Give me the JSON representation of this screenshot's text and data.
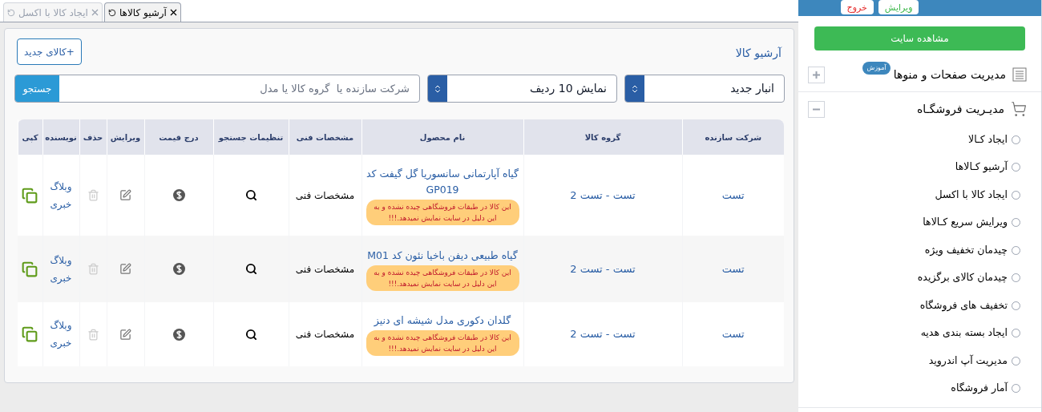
{
  "tabs": [
    {
      "label": "آرشیو کالاها",
      "selected": true
    },
    {
      "label": "ایجاد کالا با اکسل",
      "selected": false
    }
  ],
  "panel": {
    "title": "آرشیو کالا",
    "new_button": "+کالای جدید"
  },
  "filters": {
    "warehouse": "انبار جدید",
    "rows": "نمایش 10 ردیف",
    "search": {
      "placeholder": "شرکت سازنده یا  گروه کالا یا مدل"
    },
    "search_button": "جستجو"
  },
  "table": {
    "columns": [
      "شرکت سازنده",
      "گروه کالا",
      "نام محصول",
      "مشخصات فنی",
      "تنظیمات جستجو",
      "درج قیمت",
      "ویرایش",
      "حذف",
      "نویسنده",
      "کپی"
    ],
    "rows": [
      {
        "maker": "تست",
        "group": "تست - تست 2",
        "name": "گیاه آپارتمانی سانسوریا گل گیفت کد GP019",
        "warning": "این کالا در طبقات فروشگاهی چیده نشده و به این دلیل در سایت نمایش نمیدهد.!!!",
        "spec": "مشخصات فنی",
        "author": "وبلاگ خبری"
      },
      {
        "maker": "تست",
        "group": "تست - تست 2",
        "name": "گیاه طبیعی دیفن باخیا نئون کد M01",
        "warning": "این کالا در طبقات فروشگاهی چیده نشده و به این دلیل در سایت نمایش نمیدهد.!!!",
        "spec": "مشخصات فنی",
        "author": "وبلاگ خبری"
      },
      {
        "maker": "تست",
        "group": "تست - تست 2",
        "name": "گلدان دکوری مدل شیشه ای دنیز",
        "warning": "این کالا در طبقات فروشگاهی چیده نشده و به این دلیل در سایت نمایش نمیدهد.!!!",
        "spec": "مشخصات فنی",
        "author": "وبلاگ خبری"
      }
    ]
  },
  "sidebar": {
    "top_buttons": [
      {
        "label": "ویرایش",
        "kind": "edit"
      },
      {
        "label": "خروج",
        "kind": "exit"
      }
    ],
    "view_site": "مشاهده سایت",
    "sections": [
      {
        "label": "مدیریت صفحات و منوها",
        "kind": "pages",
        "badge": "آموزش",
        "expanded": false
      },
      {
        "label": "مدیـریت فروشگـاه",
        "kind": "shop",
        "expanded": true,
        "children": [
          "ایجاد کـالا",
          "آرشیو کـالاها",
          "ایجاد کالا با اکسل",
          "ویرایش سریع کـالاها",
          "چیدمان تخفیف ویژه",
          "چیدمان کالای برگزیده",
          "تخفیف های فروشگاه",
          "ایجاد بسته بندی هدیه",
          "مدیریت آپ اندروید",
          "آمار فروشگاه"
        ]
      }
    ]
  }
}
